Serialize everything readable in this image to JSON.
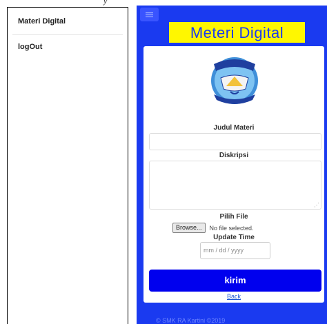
{
  "sidebar": {
    "items": [
      {
        "label": "Materi Digital"
      },
      {
        "label": "logOut"
      }
    ]
  },
  "top_caption": "y",
  "header": {
    "menu_icon": "hamburger-icon",
    "brand": "Meteri Digital",
    "brand_bg": "#fff700",
    "accent": "#1a3af0"
  },
  "form": {
    "logo_icon": "school-crest-icon",
    "title_label": "Judul Materi",
    "title_value": "",
    "description_label": "Diskripsi",
    "description_value": "",
    "file_label": "Pilih File",
    "browse_label": "Browse...",
    "file_status": "No file selected.",
    "date_label": "Update Time",
    "date_placeholder": "mm / dd / yyyy",
    "submit_label": "kirim",
    "back_label": "Back"
  },
  "footer": {
    "text": "© SMK RA Kartini ©2019"
  }
}
